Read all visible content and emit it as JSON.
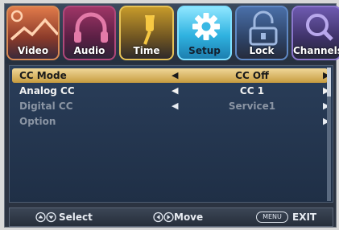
{
  "tabs": [
    {
      "label": "Video",
      "icon": "video-icon",
      "active": false
    },
    {
      "label": "Audio",
      "icon": "headphones-icon",
      "active": false
    },
    {
      "label": "Time",
      "icon": "pin-icon",
      "active": false
    },
    {
      "label": "Setup",
      "icon": "gear-icon",
      "active": true
    },
    {
      "label": "Lock",
      "icon": "lock-icon",
      "active": false
    },
    {
      "label": "Channels",
      "icon": "search-icon",
      "active": false
    }
  ],
  "menu": {
    "rows": [
      {
        "label": "CC Mode",
        "value": "CC Off",
        "state": "selected"
      },
      {
        "label": "Analog CC",
        "value": "CC 1",
        "state": "normal"
      },
      {
        "label": "Digital CC",
        "value": "Service1",
        "state": "disabled"
      },
      {
        "label": "Option",
        "value": "",
        "state": "disabled"
      }
    ]
  },
  "footer": {
    "select_label": "Select",
    "move_label": "Move",
    "menu_key": "MENU",
    "exit_label": "EXIT"
  },
  "colors": {
    "highlight": "#e3c47a",
    "panel": "#25374f",
    "video_tab": "#d47a4a",
    "audio_tab": "#8a2e5a",
    "time_tab": "#e0b43a",
    "setup_tab": "#36b7e0",
    "lock_tab": "#4a6fa8",
    "channels_tab": "#6e5ab0"
  }
}
